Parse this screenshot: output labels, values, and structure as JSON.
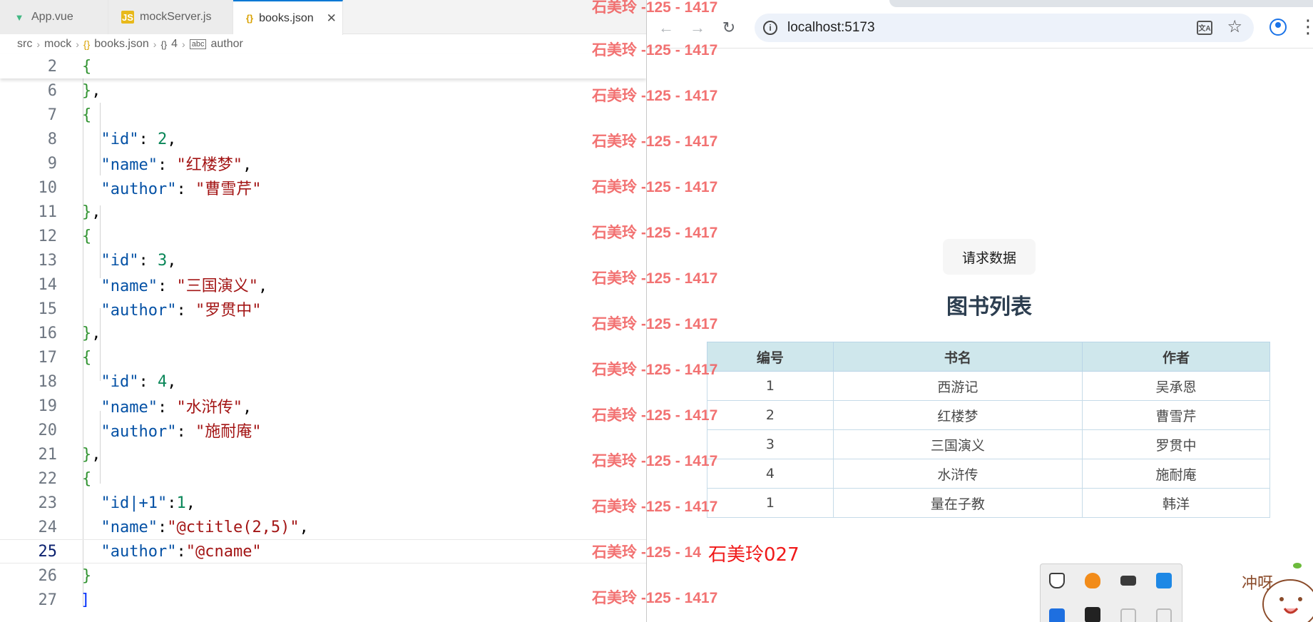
{
  "editor": {
    "tabs": [
      {
        "label": "App.vue",
        "icon": "vue-icon"
      },
      {
        "label": "mockServer.js",
        "icon": "js-icon"
      },
      {
        "label": "books.json",
        "icon": "json-icon",
        "active": true
      }
    ],
    "breadcrumb": [
      "src",
      "mock",
      "books.json",
      "4",
      "author"
    ],
    "lines": [
      {
        "n": "2"
      },
      {
        "n": "6"
      },
      {
        "n": "7"
      },
      {
        "n": "8"
      },
      {
        "n": "9"
      },
      {
        "n": "10"
      },
      {
        "n": "11"
      },
      {
        "n": "12"
      },
      {
        "n": "13"
      },
      {
        "n": "14"
      },
      {
        "n": "15"
      },
      {
        "n": "16"
      },
      {
        "n": "17"
      },
      {
        "n": "18"
      },
      {
        "n": "19"
      },
      {
        "n": "20"
      },
      {
        "n": "21"
      },
      {
        "n": "22"
      },
      {
        "n": "23"
      },
      {
        "n": "24"
      },
      {
        "n": "25"
      },
      {
        "n": "26"
      },
      {
        "n": "27"
      }
    ],
    "code": {
      "id2_key": "\"id\"",
      "id2_val": "2",
      "name2_key": "\"name\"",
      "name2_val": "\"红楼梦\"",
      "author2_key": "\"author\"",
      "author2_val": "\"曹雪芹\"",
      "id3_key": "\"id\"",
      "id3_val": "3",
      "name3_key": "\"name\"",
      "name3_val": "\"三国演义\"",
      "author3_key": "\"author\"",
      "author3_val": "\"罗贯中\"",
      "id4_key": "\"id\"",
      "id4_val": "4",
      "name4_key": "\"name\"",
      "name4_val": "\"水浒传\"",
      "author4_key": "\"author\"",
      "author4_val": "\"施耐庵\"",
      "id5_key": "\"id|+1\"",
      "id5_val": "1",
      "name5_key": "\"name\"",
      "name5_val": "\"@ctitle(2,5)\"",
      "author5_key": "\"author\"",
      "author5_val": "\"@cname\""
    }
  },
  "watermark": {
    "text": "石美玲 -125 - 1417",
    "partial": "石美玲 -125 - 14"
  },
  "browser": {
    "url": "localhost:5173",
    "request_button": "请求数据",
    "list_title": "图书列表",
    "table": {
      "headers": [
        "编号",
        "书名",
        "作者"
      ],
      "rows": [
        [
          "1",
          "西游记",
          "吴承恩"
        ],
        [
          "2",
          "红楼梦",
          "曹雪芹"
        ],
        [
          "3",
          "三国演义",
          "罗贯中"
        ],
        [
          "4",
          "水浒传",
          "施耐庵"
        ],
        [
          "1",
          "量在子教",
          "韩洋"
        ]
      ]
    },
    "signature": "石美玲027",
    "mascot_text": "冲呀"
  },
  "colors": {
    "accent": "#0078d4",
    "watermark": "#f05a5a",
    "table_header": "#cfe7ec",
    "signature": "#f01919"
  }
}
